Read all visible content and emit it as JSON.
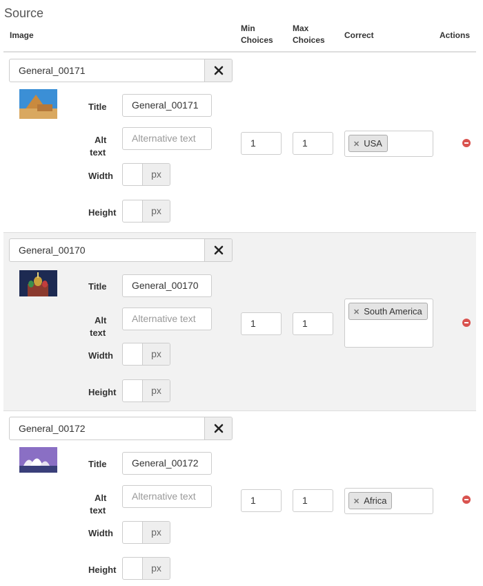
{
  "section_title": "Source",
  "columns": {
    "image": "Image",
    "min_choices": [
      "Min",
      "Choices"
    ],
    "max_choices": [
      "Max",
      "Choices"
    ],
    "correct": "Correct",
    "actions": "Actions"
  },
  "labels": {
    "title": "Title",
    "alt_text": [
      "Alt",
      "text"
    ],
    "width": "Width",
    "height": "Height",
    "unit": "px",
    "alt_placeholder": "Alternative text"
  },
  "rows": [
    {
      "name": "General_00171",
      "title_value": "General_00171",
      "min": "1",
      "max": "1",
      "correct_tags": [
        "USA"
      ],
      "thumbnail": "pyramid-sphinx-image"
    },
    {
      "name": "General_00170",
      "title_value": "General_00170",
      "min": "1",
      "max": "1",
      "correct_tags": [
        "South America"
      ],
      "thumbnail": "st-basils-cathedral-image"
    },
    {
      "name": "General_00172",
      "title_value": "General_00172",
      "min": "1",
      "max": "1",
      "correct_tags": [
        "Africa"
      ],
      "thumbnail": "sydney-opera-house-image"
    }
  ],
  "colors": {
    "accent_remove": "#d9534f",
    "row_alt_bg": "#f2f2f2"
  }
}
